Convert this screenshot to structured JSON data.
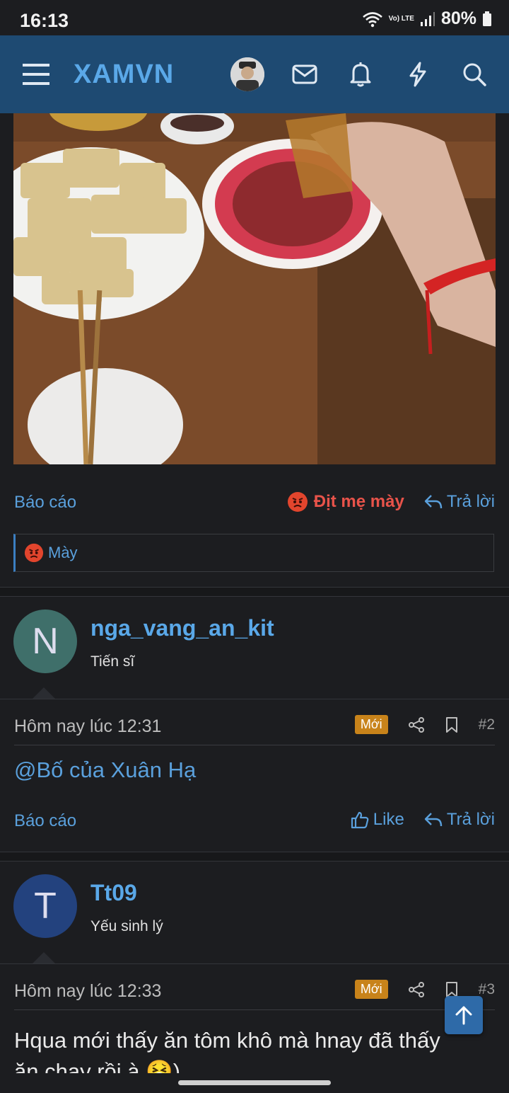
{
  "status_bar": {
    "time": "16:13",
    "battery": "80%",
    "network": "Vo) LTE"
  },
  "navbar": {
    "brand": "XAMVN"
  },
  "post1": {
    "report_label": "Báo cáo",
    "reaction_label": "Địt mẹ mày",
    "reply_label": "Trả lời",
    "reaction_summary": "Mày"
  },
  "post2": {
    "author": {
      "initial": "N",
      "name": "nga_vang_an_kit",
      "title": "Tiến sĩ",
      "avatar_color": "#3f6f6a"
    },
    "date": "Hôm nay lúc 12:31",
    "badge": "Mới",
    "number": "#2",
    "body": "@Bố của Xuân Hạ",
    "report_label": "Báo cáo",
    "like_label": "Like",
    "reply_label": "Trả lời"
  },
  "post3": {
    "author": {
      "initial": "T",
      "name": "Tt09",
      "title": "Yếu sinh lý",
      "avatar_color": "#23427e"
    },
    "date": "Hôm nay lúc 12:33",
    "badge": "Mới",
    "number": "#3",
    "body_line1": "Hqua mới thấy ăn tôm khô mà hnay đã thấy",
    "body_line2": "ăn chay rồi à 🤮)"
  },
  "colors": {
    "accent": "#5aa8e8",
    "navbar": "#1e4a72",
    "badge": "#c8831a",
    "reaction": "#e8534a"
  }
}
